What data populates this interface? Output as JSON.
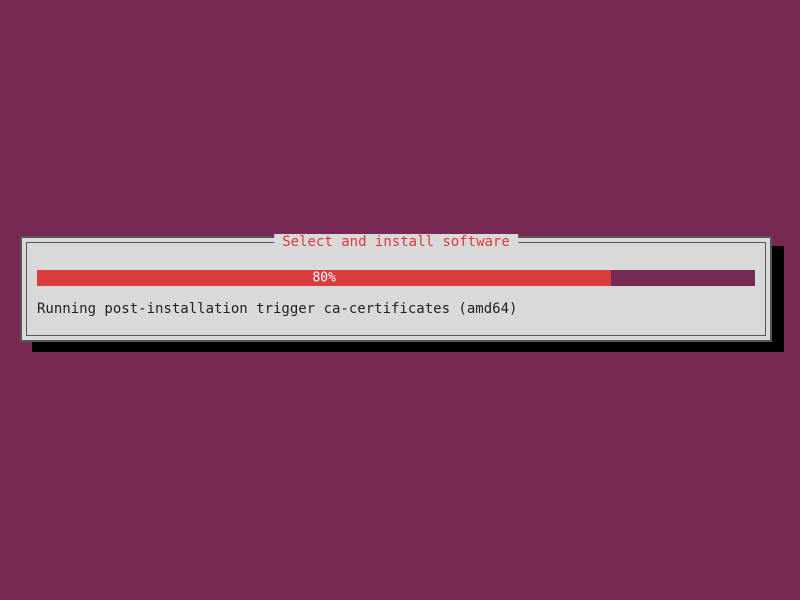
{
  "dialog": {
    "title": "Select and install software",
    "progress": {
      "percent": 80,
      "label": "80%"
    },
    "status": "Running post-installation trigger ca-certificates (amd64)"
  },
  "colors": {
    "background": "#772953",
    "accent": "#d83c3c",
    "panel": "#d9d9d9"
  }
}
